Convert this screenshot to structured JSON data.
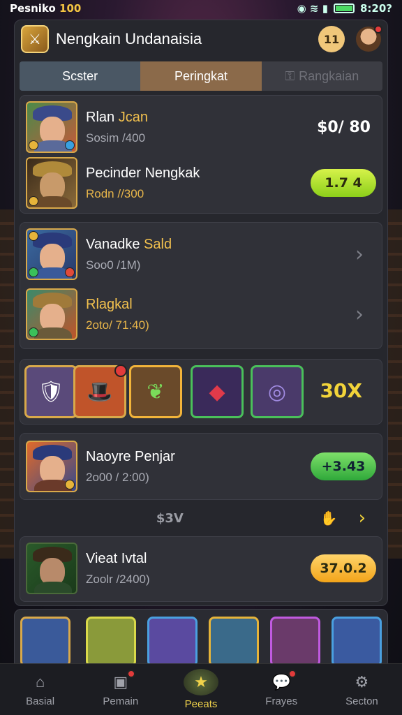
{
  "status": {
    "left_text": "Pesniko",
    "left_number": "100",
    "time": "8:20?"
  },
  "header": {
    "title": "Nengkain Undanaisia",
    "round_button": "11"
  },
  "tabs": [
    "Scster",
    "Peringkat",
    "Rangkaian"
  ],
  "group1": [
    {
      "name": "Rlan",
      "name_accent": "Jcan",
      "sub": "Sosim /400",
      "sub_accent": false,
      "price": "$0/ 80"
    },
    {
      "name": "Pecinder Nengkak",
      "name_accent": "",
      "sub": "Rodn //300",
      "sub_accent": true,
      "pill": "1.7 4"
    }
  ],
  "group2": [
    {
      "name": "Vanadke",
      "name_accent": "Sald",
      "sub": "Soo0 /1M)"
    },
    {
      "name": "",
      "name_accent": "Rlagkal",
      "sub": "2oto/ 71:40)"
    }
  ],
  "items_strip": {
    "multiplier": "30X"
  },
  "single_row": {
    "name": "Naoyre Penjar",
    "sub": "2o00 / 2:00)",
    "pill": "+3.43"
  },
  "footer_line": {
    "label": "$3V"
  },
  "last_row": {
    "name": "Vieat Ivtal",
    "sub": "Zoolr /2400)",
    "pill": "37.0.2"
  },
  "nav": [
    {
      "label": "Basial",
      "icon": "home-icon"
    },
    {
      "label": "Pemain",
      "icon": "players-icon"
    },
    {
      "label": "Peeats",
      "icon": "star-icon"
    },
    {
      "label": "Frayes",
      "icon": "chat-icon"
    },
    {
      "label": "Secton",
      "icon": "gear-icon"
    }
  ],
  "colors": {
    "accent_gold": "#f2c14e",
    "panel": "#26272d"
  }
}
